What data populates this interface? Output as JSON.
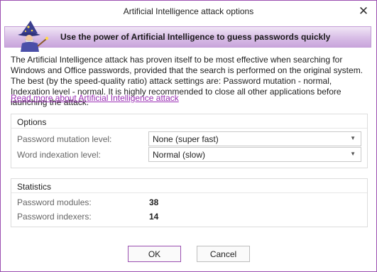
{
  "window": {
    "title": "Artificial Intelligence attack options",
    "close_glyph": "✕"
  },
  "banner": {
    "text": "Use the power of Artificial Intelligence to guess passwords quickly",
    "icon": "wizard-icon"
  },
  "description": "The Artificial Intelligence attack has proven itself to be most effective when searching for Windows and Office passwords, provided that the search is performed on the original system. The best (by the speed-quality ratio) attack settings are: Password mutation - normal, Indexation level - normal. It is highly recommended to close all other applications before launching the attack.",
  "read_more_link": "Read more about Artificial Intelligence attack",
  "options": {
    "title": "Options",
    "password_mutation": {
      "label": "Password mutation level:",
      "value": "None (super fast)"
    },
    "word_indexation": {
      "label": "Word indexation level:",
      "value": "Normal (slow)"
    }
  },
  "statistics": {
    "title": "Statistics",
    "password_modules": {
      "label": "Password modules:",
      "value": "38"
    },
    "password_indexers": {
      "label": "Password indexers:",
      "value": "14"
    }
  },
  "buttons": {
    "ok": "OK",
    "cancel": "Cancel"
  },
  "colors": {
    "accent": "#9b4fb1",
    "link": "#9b2fb5",
    "banner_bottom": "#c9a6dc"
  }
}
